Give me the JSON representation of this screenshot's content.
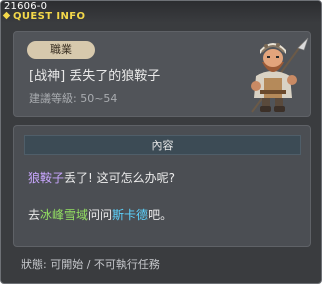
{
  "window": {
    "quest_id": "21606-0",
    "title": "QUEST INFO"
  },
  "quest": {
    "job_label": "職業",
    "name": "[战神] 丢失了的狼鞍子",
    "recommended_level": "建議等級: 50~54"
  },
  "content": {
    "header": "內容",
    "line1": {
      "item": "狼鞍子",
      "rest": "丢了! 这可怎么办呢?"
    },
    "line2": {
      "prefix": "去",
      "location": "冰峰雪域",
      "middle": "问问",
      "npc": "斯卡德",
      "suffix": "吧。"
    }
  },
  "status": {
    "text": "狀態: 可開始 / 不可執行任務"
  },
  "colors": {
    "title": "#f3d84a",
    "item_highlight": "#c9a7ff",
    "location_highlight": "#93e062",
    "npc_highlight": "#5cd4ff"
  },
  "icons": {
    "title_marker": "yellow-diamond-icon",
    "npc_portrait": "warrior-with-spear-icon"
  }
}
